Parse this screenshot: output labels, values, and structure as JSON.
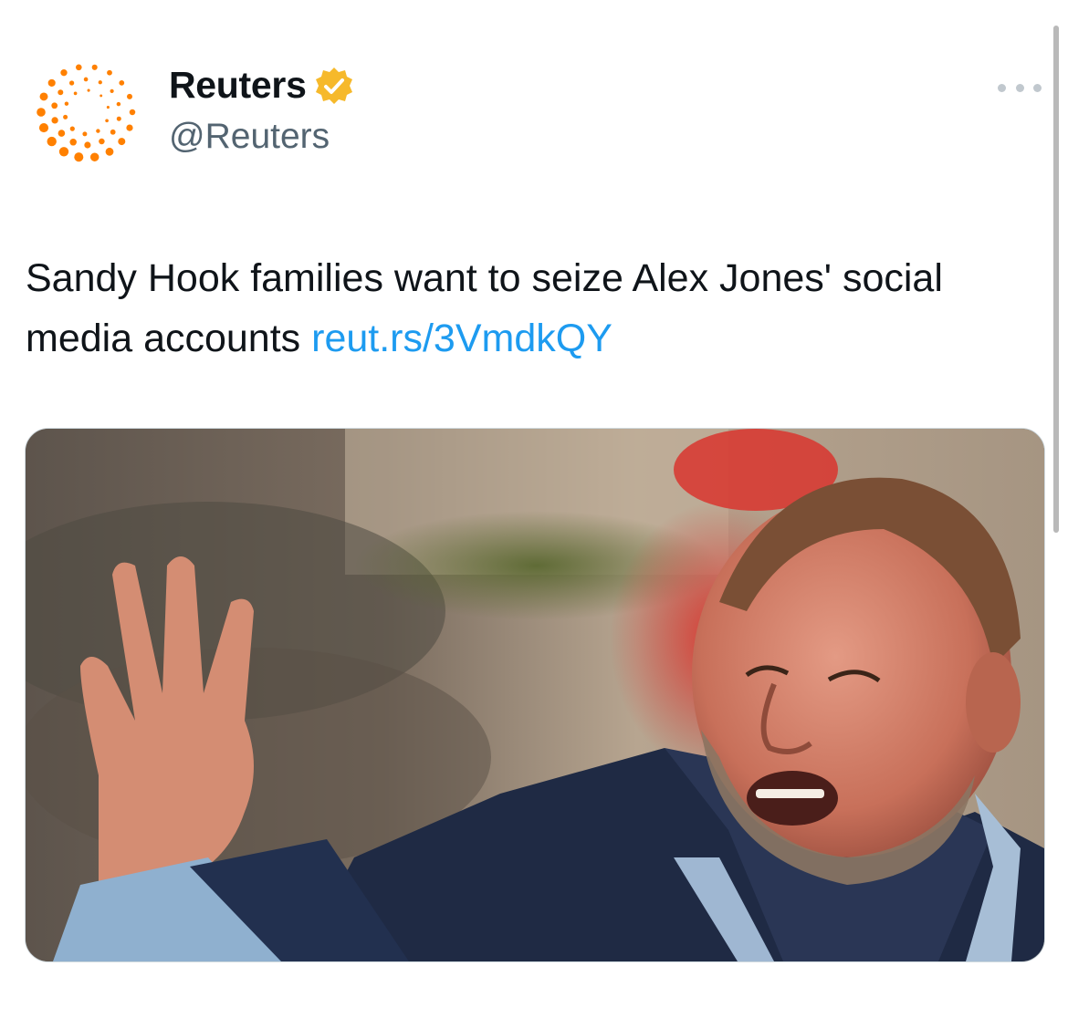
{
  "tweet": {
    "author": {
      "display_name": "Reuters",
      "handle": "@Reuters",
      "verified": true,
      "avatar_icon": "reuters-logo-icon",
      "brand_color": "#ff8000"
    },
    "menu_icon": "more-options-icon",
    "text": "Sandy Hook families want to seize Alex Jones' social media accounts",
    "link_text": "reut.rs/3VmdkQY",
    "link_color": "#1d9bf0",
    "media": {
      "type": "photo",
      "subject": "man in navy blazer gesturing with raised hand"
    }
  }
}
